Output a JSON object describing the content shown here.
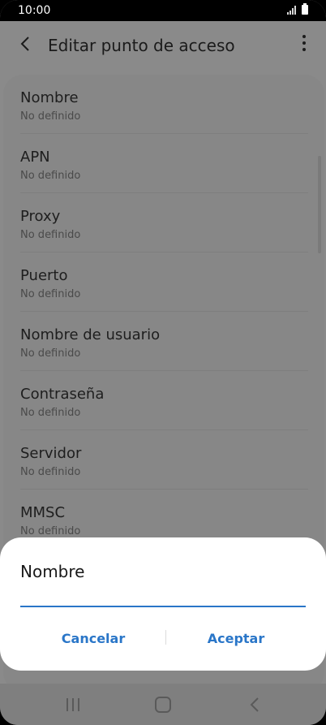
{
  "status": {
    "time": "10:00"
  },
  "header": {
    "title": "Editar punto de acceso"
  },
  "list": [
    {
      "title": "Nombre",
      "value": "No definido"
    },
    {
      "title": "APN",
      "value": "No definido"
    },
    {
      "title": "Proxy",
      "value": "No definido"
    },
    {
      "title": "Puerto",
      "value": "No definido"
    },
    {
      "title": "Nombre de usuario",
      "value": "No definido"
    },
    {
      "title": "Contraseña",
      "value": "No definido"
    },
    {
      "title": "Servidor",
      "value": "No definido"
    },
    {
      "title": "MMSC",
      "value": "No definido"
    }
  ],
  "dialog": {
    "title": "Nombre",
    "input_value": "",
    "cancel_label": "Cancelar",
    "accept_label": "Aceptar"
  },
  "colors": {
    "accent": "#2a76c8",
    "scrim": "#8a8a8a",
    "dialog_bg": "#ffffff"
  }
}
